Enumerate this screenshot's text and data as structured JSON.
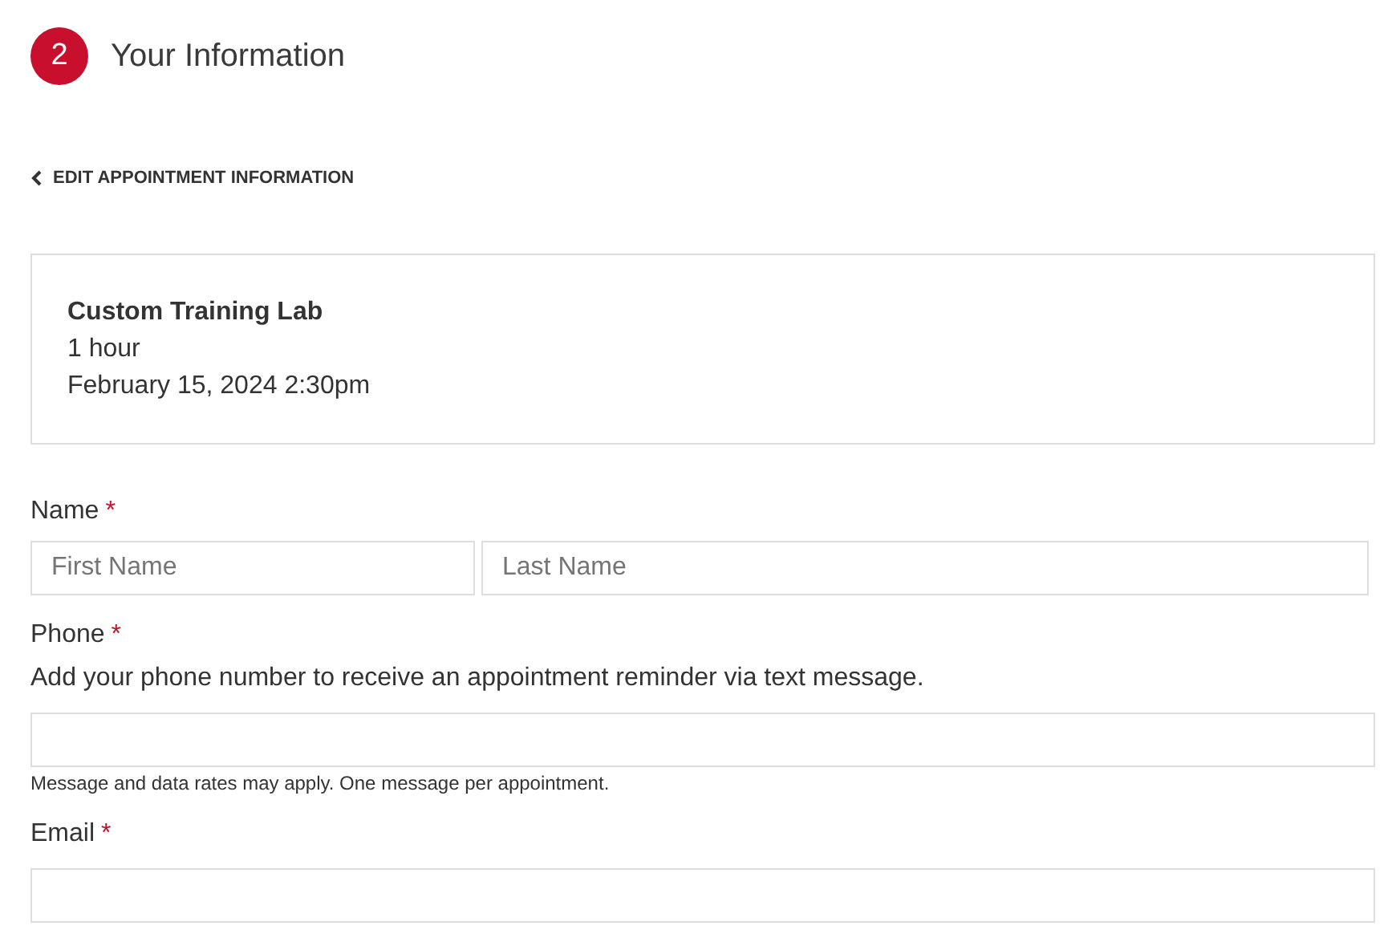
{
  "step": {
    "number": "2",
    "title": "Your Information"
  },
  "back_link": {
    "label": "EDIT APPOINTMENT INFORMATION"
  },
  "appointment": {
    "service": "Custom Training Lab",
    "duration": "1 hour",
    "datetime": "February 15, 2024 2:30pm"
  },
  "fields": [
    {
      "kind": "name",
      "label": "Name",
      "required_mark": "*",
      "inputs": [
        {
          "placeholder": "First Name"
        },
        {
          "placeholder": "Last Name"
        }
      ]
    },
    {
      "kind": "single",
      "label": "Phone",
      "required_mark": "*",
      "help": "Add your phone number to receive an appointment reminder via text message.",
      "note": "Message and data rates may apply. One message per appointment."
    },
    {
      "kind": "single",
      "label": "Email",
      "required_mark": "*"
    }
  ]
}
